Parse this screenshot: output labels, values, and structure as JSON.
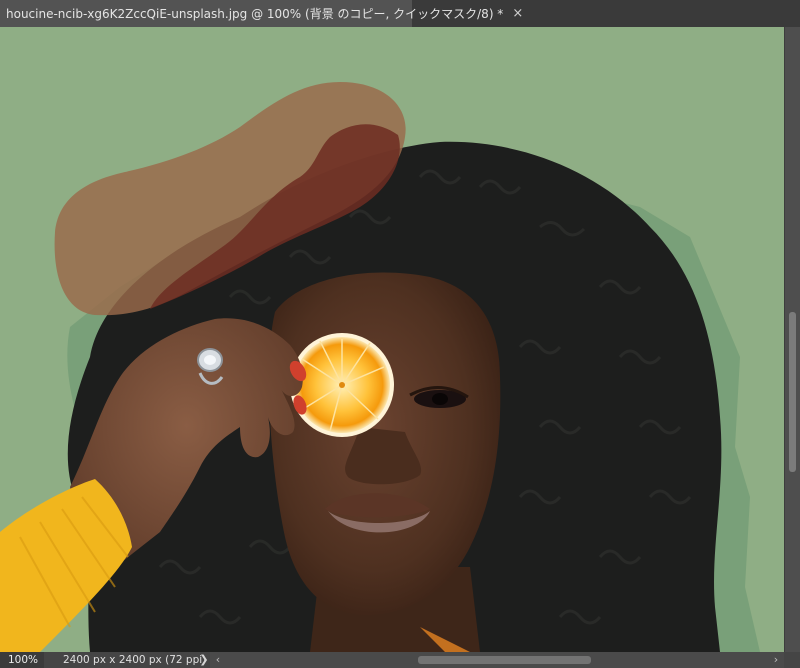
{
  "document_tab": {
    "title": "houcine-ncib-xg6K2ZccQiE-unsplash.jpg @ 100% (背景 のコピー, クイックマスク/8) *",
    "close_label": "×"
  },
  "status_bar": {
    "zoom": "100%",
    "doc_info": "2400 px x 2400 px (72 ppi)",
    "menu_arrow": "❯"
  },
  "scrollbar": {
    "left_arrow": "‹",
    "right_arrow": "›"
  },
  "colors": {
    "background_green": "#8fae85",
    "quick_mask_overlay": "#9a6a4a",
    "hair": "#1d1e1d",
    "skin": "#5c3a26",
    "orange": "#f7b227",
    "sweater": "#f1b61d"
  }
}
